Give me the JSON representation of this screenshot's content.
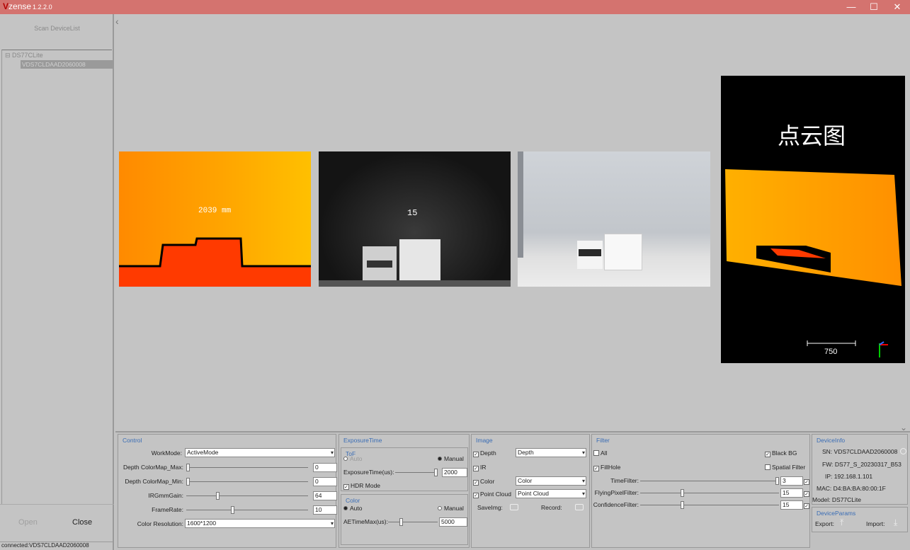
{
  "app": {
    "name_prefix": "V",
    "name_rest": "zense",
    "version": "1.2.2.0"
  },
  "window_controls": {
    "minimize": "—",
    "maximize": "☐",
    "close": "✕"
  },
  "sidebar": {
    "scan_button": "Scan DeviceList",
    "tree": {
      "root": "DS77CLite",
      "child": "VDS7CLDAAD2060008"
    },
    "open_button": "Open",
    "close_button": "Close",
    "status": "connected:VDS7CLDAAD2060008"
  },
  "views": {
    "depth_label": "2039 mm",
    "ir_label": "15",
    "pointcloud_title": "点云图",
    "pointcloud_scale": "750"
  },
  "control": {
    "title": "Control",
    "workmode_label": "WorkMode:",
    "workmode_value": "ActiveMode",
    "depth_max_label": "Depth ColorMap_Max:",
    "depth_max_value": "0",
    "depth_max_level": 0,
    "depth_min_label": "Depth ColorMap_Min:",
    "depth_min_value": "0",
    "depth_min_level": 0,
    "irgain_label": "IRGmmGain:",
    "irgain_value": "64",
    "irgain_level": 0.25,
    "framerate_label": "FrameRate:",
    "framerate_value": "10",
    "framerate_level": 0.38,
    "resolution_label": "Color Resolution:",
    "resolution_value": "1600*1200"
  },
  "exposure": {
    "title": "ExposureTime",
    "tof_title": "ToF",
    "auto_label": "Auto",
    "manual_label": "Manual",
    "exposure_label": "ExposureTime(us):",
    "exposure_value": "2000",
    "exposure_level": 1.0,
    "hdr_label": "HDR Mode",
    "color_title": "Color",
    "color_auto_label": "Auto",
    "color_manual_label": "Manual",
    "ae_label": "AETimeMax(us):",
    "ae_value": "5000",
    "ae_level": 0.25
  },
  "image": {
    "title": "Image",
    "depth_label": "Depth",
    "depth_combo": "Depth",
    "ir_label": "IR",
    "color_label": "Color",
    "color_combo": "Color",
    "pc_label": "Point Cloud",
    "pc_combo": "Point Cloud",
    "saveimg_label": "SaveImg:",
    "record_label": "Record:"
  },
  "filter": {
    "title": "Filter",
    "all_label": "All",
    "blackbg_label": "Black BG",
    "fillhole_label": "FillHole",
    "spatial_label": "Spatial Filter",
    "time_label": "TimeFilter:",
    "time_value": "3",
    "time_level": 1.0,
    "flying_label": "FlyingPixelFilter:",
    "flying_value": "15",
    "flying_level": 0.3,
    "confidence_label": "ConfidenceFilter:",
    "confidence_value": "15",
    "confidence_level": 0.3
  },
  "deviceinfo": {
    "title": "DeviceInfo",
    "sn_label": "SN:",
    "sn_value": "VDS7CLDAAD2060008",
    "fw_label": "FW:",
    "fw_value": "DS77_S_20230317_B53",
    "ip_label": "IP:",
    "ip_value": "192.168.1.101",
    "mac_label": "MAC:",
    "mac_value": "D4:BA:BA:80:00:1F",
    "model_label": "Model:",
    "model_value": "DS77CLite"
  },
  "deviceparams": {
    "title": "DeviceParams",
    "export_label": "Export:",
    "import_label": "Import:"
  },
  "colors": {
    "titlebar": "#d4736f",
    "accent": "#3a6db5"
  }
}
